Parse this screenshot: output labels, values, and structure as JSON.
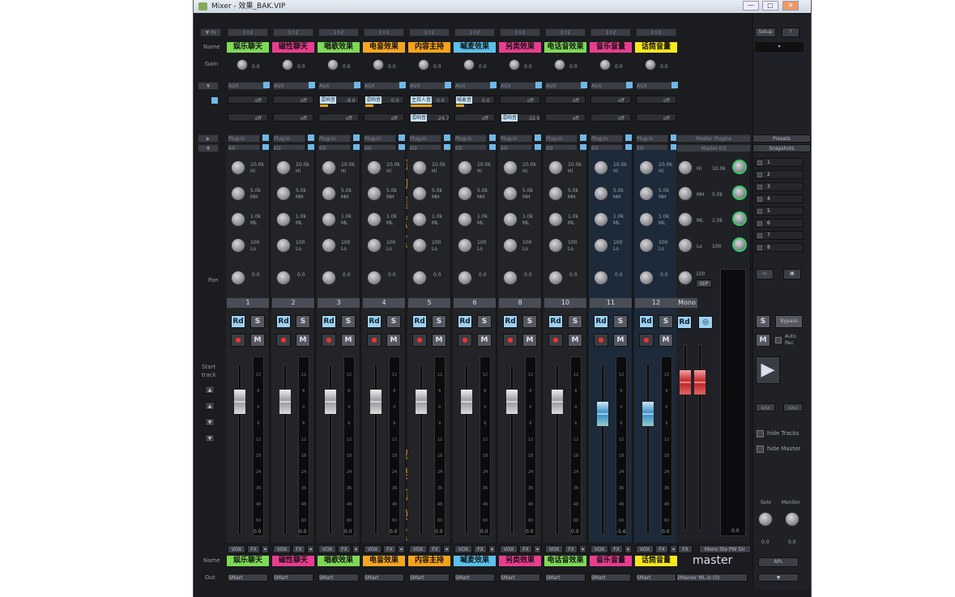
{
  "window": {
    "title": "Mixer - 效果_BAK.VIP",
    "min": "—",
    "max": "□",
    "close": "✕"
  },
  "left_labels": {
    "name": "Name",
    "gain": "Gain",
    "pan": "Pan",
    "start_track": "Start track",
    "out": "Out"
  },
  "eq_title": [
    "均",
    "匀",
    "调",
    "试",
    "区"
  ],
  "fx_title": [
    "效",
    "果",
    "切",
    "换",
    "区"
  ],
  "header_btn_text": "1+2",
  "aux_text": "AUX",
  "plugin_text": "Plug-in",
  "eq_text": "EQ",
  "setup": "Setup",
  "help": "?",
  "channels": [
    {
      "name": "娱乐聊天",
      "color": "#7ed957",
      "num": "1",
      "gain": "0.0",
      "hi": "10.0k",
      "mh": "5.0k",
      "ml": "1.0k",
      "lo": "100",
      "pan": "0.0",
      "meter_bottom": "0.0",
      "out": "SMart",
      "fx1": "",
      "fx2": "",
      "fx1v": "",
      "fx2v": ""
    },
    {
      "name": "磁性聊天",
      "color": "#e83d8f",
      "num": "2",
      "gain": "0.0",
      "hi": "10.0k",
      "mh": "5.0k",
      "ml": "1.0k",
      "lo": "100",
      "pan": "0.0",
      "meter_bottom": "0.0",
      "out": "SMart",
      "fx1": "",
      "fx2": "",
      "fx1v": "",
      "fx2v": ""
    },
    {
      "name": "唱歌效果",
      "color": "#7ed957",
      "num": "3",
      "gain": "0.0",
      "hi": "10.0k",
      "mh": "5.0k",
      "ml": "1.0k",
      "lo": "100",
      "pan": "0.0",
      "meter_bottom": "0.0",
      "out": "SMart",
      "fx1": "混响音",
      "fx2": "",
      "fx1v": "-8.0",
      "fx2v": ""
    },
    {
      "name": "电音效果",
      "color": "#f5a623",
      "num": "4",
      "gain": "0.0",
      "hi": "10.0k",
      "mh": "5.0k",
      "ml": "1.0k",
      "lo": "100",
      "pan": "0.0",
      "meter_bottom": "0.0",
      "out": "SMart",
      "fx1": "混响音",
      "fx2": "",
      "fx1v": "0.0",
      "fx2v": ""
    },
    {
      "name": "内容主持",
      "color": "#f7a21b",
      "num": "5",
      "gain": "0.0",
      "hi": "10.0k",
      "mh": "5.0k",
      "ml": "1.0k",
      "lo": "100",
      "pan": "0.0",
      "meter_bottom": "0.0",
      "out": "SMart",
      "fx1": "主持人音",
      "fx2": "混响音",
      "fx1v": "0.0",
      "fx2v": "-24.7"
    },
    {
      "name": "喊麦效果",
      "color": "#5bc0eb",
      "num": "6",
      "gain": "0.0",
      "hi": "10.0k",
      "mh": "5.0k",
      "ml": "1.0k",
      "lo": "100",
      "pan": "0.0",
      "meter_bottom": "0.0",
      "out": "SMart",
      "fx1": "喊麦音",
      "fx2": "",
      "fx1v": "0.0",
      "fx2v": ""
    },
    {
      "name": "另类效果",
      "color": "#e83d8f",
      "num": "8",
      "gain": "0.0",
      "hi": "10.0k",
      "mh": "5.0k",
      "ml": "1.0k",
      "lo": "100",
      "pan": "0.0",
      "meter_bottom": "0.0",
      "out": "SMart",
      "fx1": "",
      "fx2": "混响音",
      "fx1v": "",
      "fx2v": "-32.9"
    },
    {
      "name": "电话音效果",
      "color": "#7ed957",
      "num": "10",
      "gain": "0.0",
      "hi": "10.0k",
      "mh": "5.0k",
      "ml": "1.0k",
      "lo": "100",
      "pan": "0.0",
      "meter_bottom": "0.0",
      "out": "SMart",
      "fx1": "",
      "fx2": "",
      "fx1v": "",
      "fx2v": ""
    },
    {
      "name": "音乐音量",
      "color": "#e83d8f",
      "num": "11",
      "gain": "0.0",
      "hi": "10.0k",
      "mh": "5.0k",
      "ml": "1.0k",
      "lo": "100",
      "pan": "0.0",
      "meter_bottom": "-5.6",
      "out": "SMart",
      "fx1": "",
      "fx2": "",
      "fx1v": "",
      "fx2v": ""
    },
    {
      "name": "话筒音量",
      "color": "#f8e71c",
      "num": "12",
      "gain": "0.0",
      "hi": "10.0k",
      "mh": "5.0k",
      "ml": "1.0k",
      "lo": "100",
      "pan": "0.0",
      "meter_bottom": "0.0",
      "out": "SMart",
      "fx1": "",
      "fx2": "",
      "fx1v": "",
      "fx2v": ""
    }
  ],
  "strip_btn": {
    "rd": "Rd",
    "s": "S",
    "m": "M",
    "rec": "●",
    "vox": "VOX",
    "fx": "FX"
  },
  "meter_ticks": [
    "12",
    "6",
    "0",
    "6",
    "12",
    "18",
    "24",
    "36",
    "48",
    "60",
    "0.0"
  ],
  "master_eq": {
    "hi_label": "Hi",
    "hi_val": "10.0k",
    "mh_label": "MH",
    "mh_val": "5.0k",
    "ml_label": "ML",
    "ml_val": "1.0k",
    "lo_label": "Lo",
    "lo_val": "100",
    "pan_val": "100",
    "sep": "SEP"
  },
  "eq_labels": {
    "hi": "Hi",
    "mh": "MH",
    "ml": "ML",
    "lo": "Lo"
  },
  "master": {
    "label": "master",
    "mono": "Mono",
    "rd": "Rd",
    "fx": "FX",
    "mono_stereo": "Mono Ste PW Dir",
    "out": "2Mainer ML.io (0)",
    "master_plugin": "Master Plugins",
    "master_eq": "Master EQ",
    "fader_db": "0.0"
  },
  "right_panel": {
    "s": "S",
    "bypass": "Bypass",
    "m": "M",
    "auto_rec": "Auto Rec",
    "play": "▶",
    "hide_tracks": "hide Tracks",
    "hide_master": "hide Master",
    "solo": "Solo",
    "monitor": "Monitor",
    "solo_val": "0.0",
    "monitor_val": "0.0",
    "apl": "APL",
    "presets": "Presets",
    "snapshots": "Snapshots",
    "preset_list": [
      "1",
      "2",
      "3",
      "4",
      "5",
      "6",
      "7",
      "8"
    ],
    "pfl": "▼"
  },
  "fx_off": "off"
}
